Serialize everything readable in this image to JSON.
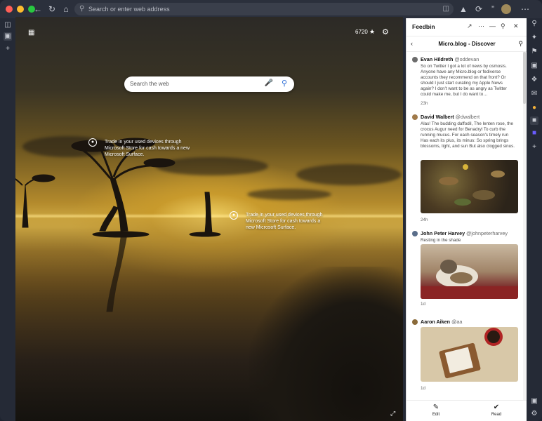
{
  "toolbar": {
    "url_placeholder": "Search or enter web address",
    "icons": [
      "back-icon",
      "reload-icon",
      "home-icon",
      "search-icon"
    ]
  },
  "newtab": {
    "search_placeholder": "Search the web",
    "score": "6720",
    "hotspot_1": "Trade in your used devices through Microsoft Store for cash towards a new Microsoft Surface.",
    "hotspot_2": "Trade in your used devices through Microsoft Store for cash towards a new Microsoft Surface."
  },
  "panel": {
    "app_title": "Feedbin",
    "feed_title": "Micro.blog - Discover",
    "posts": [
      {
        "name": "Evan Hildreth",
        "handle": "@oddevan",
        "body": "So on Twitter I got a lot of news by osmosis. Anyone have any Micro.blog or fediverse accounts they recommend on that front? Or should I just start curating my Apple News again? I don't want to be as angry as Twitter could make me, but I do want to…",
        "time": "23h"
      },
      {
        "name": "David Walbert",
        "handle": "@dwalbert",
        "body": "Alas! The budding daffodil, The lenten rose, the crocus Augur need for Benadryl To curb the running mucus. For each season's timely run Has each its plus, its minus: So spring brings blossoms, light, and sun But also clogged sinus.",
        "time": "24h"
      },
      {
        "name": "John Peter Harvey",
        "handle": "@johnpeterharvey",
        "body": "Resting in the shade",
        "time": "1d"
      },
      {
        "name": "Aaron Aiken",
        "handle": "@aa",
        "body": "",
        "time": "1d"
      }
    ],
    "footer": {
      "edit": "Edit",
      "read": "Read"
    }
  }
}
